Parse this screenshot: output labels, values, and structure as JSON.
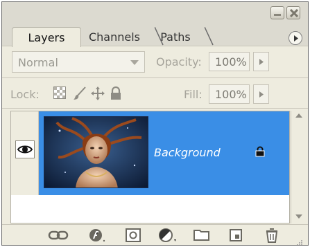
{
  "panel": {
    "tabs": [
      {
        "label": "Layers",
        "active": true
      },
      {
        "label": "Channels",
        "active": false
      },
      {
        "label": "Paths",
        "active": false
      }
    ]
  },
  "blend": {
    "mode": "Normal",
    "opacity_label": "Opacity:",
    "opacity_value": "100%"
  },
  "lock": {
    "label": "Lock:",
    "fill_label": "Fill:",
    "fill_value": "100%"
  },
  "layers": [
    {
      "name": "Background",
      "visible": true,
      "locked": true,
      "selected": true
    }
  ],
  "colors": {
    "selection": "#3a8ee6",
    "panel": "#eeecdf"
  },
  "bottom_icons": [
    "link-layers-icon",
    "layer-style-icon",
    "layer-mask-icon",
    "adjustment-layer-icon",
    "new-group-icon",
    "new-layer-icon",
    "delete-layer-icon"
  ]
}
